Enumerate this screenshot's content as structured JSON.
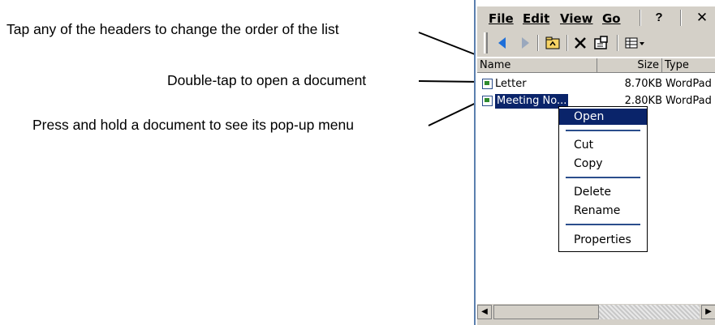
{
  "annotations": [
    "Tap any of the headers to change the order of the list",
    "Double-tap to open a document",
    "Press and hold a document to see its pop-up menu"
  ],
  "menubar": {
    "file": "File",
    "edit": "Edit",
    "view": "View",
    "go": "Go",
    "help": "?",
    "close": "✕"
  },
  "toolbar_icons": [
    "back-arrow-icon",
    "forward-arrow-icon",
    "up-folder-icon",
    "delete-icon",
    "properties-icon",
    "view-menu-icon"
  ],
  "list": {
    "headers": {
      "name": "Name",
      "size": "Size",
      "type": "Type"
    },
    "rows": [
      {
        "name": "Letter",
        "size": "8.70KB",
        "type": "WordPad"
      },
      {
        "name": "Meeting No...",
        "size": "2.80KB",
        "type": "WordPad"
      }
    ]
  },
  "popup": {
    "open": "Open",
    "cut": "Cut",
    "copy": "Copy",
    "delete": "Delete",
    "rename": "Rename",
    "properties": "Properties"
  },
  "colors": {
    "selection": "#0a246a",
    "chrome": "#d4d0c8",
    "device_border": "#5b7fae"
  }
}
